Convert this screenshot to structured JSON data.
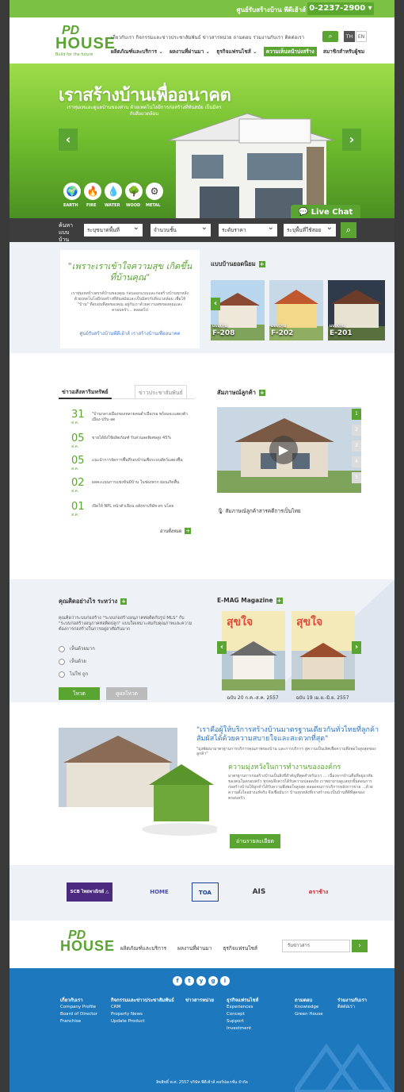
{
  "topbar": {
    "label": "ศูนย์รับสร้างบ้าน พีดีเฮ้าส์",
    "phone": "0-2237-2900"
  },
  "logo": {
    "pd": "PD",
    "house": "HOUSE",
    "tagline": "Build for the future"
  },
  "nav_top": "เกี่ยวกับเรา   กิจกรรมและข่าวประชาสัมพันธ์   ข่าวสารหน่วย   ถามตอบ   ร่วมงานกับเรา   ติดต่อเรา",
  "nav_main": [
    "ผลิตภัณฑ์และบริการ ⌄",
    "ผลงานที่ผ่านมา ⌄",
    "ธุรกิจแฟรนไชส์ ⌄",
    "ความเห็นหน้าบ่งสร้าง",
    "สมาชิกสำหรับผู้ชม"
  ],
  "lang": [
    "TH",
    "EN"
  ],
  "hero": {
    "title": "เราสร้างบ้านเพื่ออนาคต",
    "sub": "เราทุ่มเทและดูแลบ้านของท่าน ด้วยเทคโนโลยีการก่อสร้างที่ทันสมัย เป็นมิตรกับสิ่งแวดล้อม",
    "icons": [
      {
        "glyph": "🌍",
        "label": "EARTH"
      },
      {
        "glyph": "🔥",
        "label": "FIRE"
      },
      {
        "glyph": "💧",
        "label": "WATER"
      },
      {
        "glyph": "🌳",
        "label": "WOOD"
      },
      {
        "glyph": "⚙",
        "label": "METAL"
      }
    ],
    "live_chat": "Live Chat"
  },
  "search": {
    "label": "ค้นหาแบบบ้าน",
    "selects": [
      "ระบุขนาดพื้นที่",
      "จำนวนชั้น",
      "ระดับราคา",
      "ระบุพื้นที่ใช้สอย"
    ]
  },
  "intro": {
    "quote": "\"เพราะเราเข้าใจความสุข เกิดขึ้นที่บ้านคุณ\"",
    "body": "เราทุ่มเทสร้างสรรค์บ้านของคุณ ก่อนออกแบบและก่อสร้างบ้านทุกหลัง ด้วยเทคโนโลยีก่อสร้างที่ทันสมัยและเป็นมิตรกับสิ่งแวดล้อม เพื่อให้ \"บ้าน\" ที่อบอุ่นที่สุดของคุณ อยู่กับเราด้วยความสุขของคุณและครอบครัว... ตลอดไป",
    "link": "ศูนย์รับสร้างบ้านพีดีเฮ้าส์ เราสร้างบ้านเพื่ออนาคต"
  },
  "popular": {
    "title": "แบบบ้านยอดนิยม",
    "items": [
      {
        "pre": "แบบบ้าน",
        "code": "F-208"
      },
      {
        "pre": "แบบบ้าน",
        "code": "F-202"
      },
      {
        "pre": "แบบบ้าน",
        "code": "E-201"
      }
    ]
  },
  "news": {
    "tab1": "ข่าวอสังหาริมทรัพย์",
    "tab2": "ข่าวประชาสัมพันธ์",
    "items": [
      {
        "d": "31",
        "m": "ส.ค.",
        "t": "\"บ้านกลางเมืองของหลายคนต่ำเมืองรอ พร้อมจะแสดงตัวเมือง-ปรับ-ลด"
      },
      {
        "d": "05",
        "m": "ส.ค.",
        "t": "ขายได้ยังใช้ผลิตภัณฑ์ รับส่วนลดพิเศษสูง 45%"
      },
      {
        "d": "05",
        "m": "ส.ค.",
        "t": "แนะนำการจัดการพื้นที่รอบบ้านเพื่อระบบสัตว์แสดงพื้น"
      },
      {
        "d": "02",
        "m": "ส.ค.",
        "t": "ผลคะแนนการแข่งขันมีบ้าน ในช่องพวก ผ่อนเกิดพื้น"
      },
      {
        "d": "01",
        "m": "ส.ค.",
        "t": "เปิดให้ NPL หน้าตัวเลือน อสังหาบริษัท-สร บโดย"
      }
    ],
    "more": "อ่านทั้งหมด"
  },
  "interview": {
    "title": "สัมภาษณ์ลูกค้า",
    "caption": "สัมภาษณ์ลูกค้าสารคดีการเป็นไทย",
    "numbers": [
      "1",
      "2",
      "3",
      "4",
      "5"
    ]
  },
  "poll": {
    "title": "คุณคิดอย่างไร ระหว่าง",
    "question": "คุณคิดว่าระบบก่อสร้าง \"ระบบก่อสร้างอนุภาคท่อติดกับรูป MLS\" กับ \"ระบบก่อสร้างอนุภาคท่อติดปลูก\" แบบใดเหมาะสมกับคุณภาพและความต้องการก่อสร้างในการอยู่อาศัยกันมาก",
    "options": [
      "เห็นด้วยมาก",
      "เห็นด้วย",
      "ไม่ใช่ ถูก"
    ],
    "vote": "โหวต",
    "result": "ดูผลโหวต"
  },
  "emag": {
    "title": "E-MAG Magazine",
    "items": [
      {
        "cap": "ฉบับ 20 ก.ค.-ส.ค. 2557"
      },
      {
        "cap": "ฉบับ 19 เม.ย.-มิ.ย. 2557"
      }
    ]
  },
  "about": {
    "quote": "\"เราคือผู้ให้บริการสร้างบ้านมาตรฐานเดียวกันทั่วไทยที่ลูกค้าสัมผัสได้ด้วยความสบายใจและสะดวกที่สุด\"",
    "sub": "\"มุ่งพัฒนามาตรฐานการบริการคุณภาพของบ้าน และการบริการ สู่ความเป็นเลิศเพื่อความพึงพอใจสูงสุดของลูกค้า\"",
    "heading": "ความมุ่งหวังในการทำงานขององค์กร",
    "body": "มาตรฐานการก่อสร้างบ้านเป็นสิ่งที่สำคัญที่สุดสำหรับเรา ... เนื่องจากบ้านคือที่อยู่อาศัยของคนในครอบครัว ทุกคนจึงควรได้รับความปลอดภัย เราพยายามดูแลทุกขั้นตอนการก่อสร้างบ้านให้ลูกค้าได้รับความพึงพอใจสูงสุด ตลอดจนการบริการหลังการขาย ...ด้วยความตั้งใจอย่างแท้จริง จึงเชื่อมั่นว่า บ้านทุกหลังที่เราสร้างจะเป็นบ้านที่ดีที่สุดของครอบครัว",
    "button": "อ่านรายละเอียด"
  },
  "partners": [
    "SCB ไทยพาณิชย์ △",
    "HOME",
    "TOA",
    "AIS",
    "ตราช้าง"
  ],
  "footer_nav": {
    "items": [
      "ผลิตภัณฑ์และบริการ",
      "ผลงานที่ผ่านมา",
      "ธุรกิจแฟรนไชส์"
    ],
    "subscribe": "รับข่าวสาร"
  },
  "footer": {
    "social": [
      "f",
      "t",
      "y",
      "g",
      "i"
    ],
    "cols": [
      {
        "head": "เกี่ยวกับเรา",
        "items": [
          "Company Profile",
          "Board of Director",
          "Franchise"
        ]
      },
      {
        "head": "กิจกรรมและข่าวประชาสัมพันธ์",
        "items": [
          "CRM",
          "Property News",
          "Update Product"
        ]
      },
      {
        "head": "ข่าวสารหน่วย",
        "items": []
      },
      {
        "head": "ธุรกิจแฟรนไชส์",
        "items": [
          "Experiences",
          "Concept",
          "Support",
          "Investment"
        ]
      },
      {
        "head": "ถามตอบ",
        "items": [
          "Knowledge",
          "Green House"
        ]
      },
      {
        "head": "ร่วมงานกับเรา",
        "items": [
          "ติดต่อเรา"
        ]
      }
    ],
    "copy": "ลิขสิทธิ์ พ.ศ. 2557 บริษัท พีดีเฮ้าส์ คอร์ปอเรชั่น จำกัด"
  },
  "colors": {
    "brand": "#5aa531",
    "brand_light": "#7bc143",
    "footer": "#1d78bd"
  }
}
